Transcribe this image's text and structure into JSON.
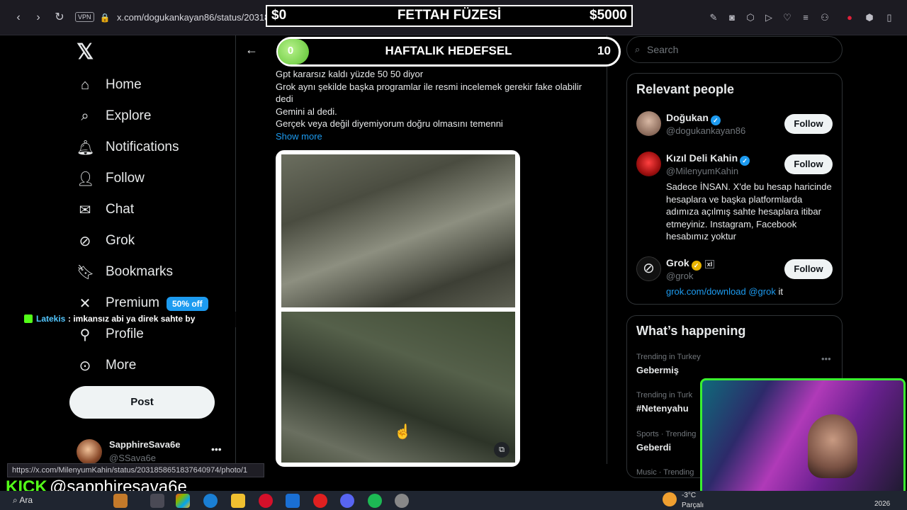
{
  "browser": {
    "vpn": "VPN",
    "url": "x.com/dogukankayan86/status/203186791...632407"
  },
  "overlay": {
    "left_amount": "$0",
    "title": "FETTAH FÜZESİ",
    "right_amount": "$5000",
    "goal_current": "0",
    "goal_title": "HAFTALIK HEDEFSEL",
    "goal_target": "10",
    "goal_progress": 0.0
  },
  "sidebar": {
    "items": [
      {
        "label": "Home",
        "icon": "home-icon"
      },
      {
        "label": "Explore",
        "icon": "search-icon"
      },
      {
        "label": "Notifications",
        "icon": "bell-icon"
      },
      {
        "label": "Follow",
        "icon": "add-person-icon"
      },
      {
        "label": "Chat",
        "icon": "mail-icon"
      },
      {
        "label": "Grok",
        "icon": "grok-icon"
      },
      {
        "label": "Bookmarks",
        "icon": "bookmark-icon"
      },
      {
        "label": "Premium",
        "icon": "x-icon"
      },
      {
        "label": "Profile",
        "icon": "person-icon"
      },
      {
        "label": "More",
        "icon": "more-circle-icon"
      }
    ],
    "premium_badge": "50% off",
    "post_label": "Post",
    "account": {
      "name": "SapphireSava6e",
      "handle": "@SSava6e"
    }
  },
  "chat_overlay": {
    "user": "Latekis",
    "message": ": imkansız abi ya direk sahte by"
  },
  "tweet": {
    "lines": [
      "Gpt kararsız kaldı yüzde 50 50 diyor",
      "Grok aynı şekilde başka programlar ile resmi incelemek gerekir fake olabilir",
      "dedi",
      "Gemini al dedi.",
      "Gerçek veya değil diyemiyorum doğru olmasını temenni"
    ],
    "show_more": "Show more"
  },
  "right": {
    "search_placeholder": "Search",
    "relevant_title": "Relevant people",
    "people": [
      {
        "name": "Doğukan",
        "handle": "@dogukankayan86",
        "follow": "Follow"
      },
      {
        "name": "Kızıl Deli Kahin",
        "handle": "@MilenyumKahin",
        "follow": "Follow",
        "bio": "Sadece İNSAN. X'de bu hesap haricinde hesaplara ve başka platformlarda adımıza açılmış sahte hesaplara itibar etmeyiniz. Instagram, Facebook hesabımız yoktur"
      },
      {
        "name": "Grok",
        "handle": "@grok",
        "follow": "Follow",
        "link": "grok.com/download",
        "mention": "@grok",
        "tail": "it"
      }
    ],
    "whats_happening": "What’s happening",
    "trends": [
      {
        "meta": "Trending in Turkey",
        "topic": "Gebermiş"
      },
      {
        "meta": "Trending in Turk",
        "topic": "#Netenyahu"
      },
      {
        "meta": "Sports · Trending",
        "topic": "Geberdi"
      },
      {
        "meta": "Music · Trending",
        "topic": ""
      }
    ]
  },
  "status_url": "https://x.com/MilenyumKahin/status/2031858651837640974/photo/1",
  "kick": {
    "logo": "KICK",
    "handle": "@sapphiresava6e"
  },
  "taskbar": {
    "search": "Ara",
    "temp": "-3°C",
    "weather": "Parçalı",
    "date": "2026"
  }
}
